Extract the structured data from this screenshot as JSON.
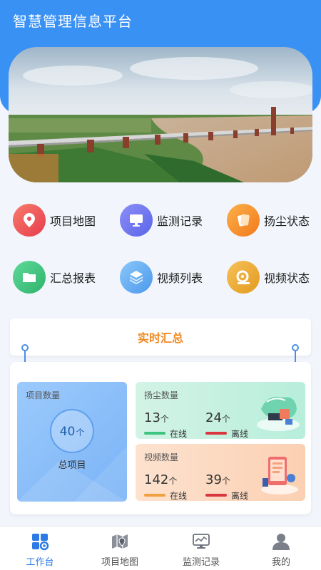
{
  "app": {
    "title": "智慧管理信息平台"
  },
  "menu": [
    {
      "label": "项目地图",
      "icon": "map-pin-icon",
      "color": "#f0565c"
    },
    {
      "label": "监测记录",
      "icon": "monitor-icon",
      "color": "#6b7cf3"
    },
    {
      "label": "扬尘状态",
      "icon": "dust-status-icon",
      "color": "#f7932c"
    },
    {
      "label": "汇总报表",
      "icon": "folder-icon",
      "color": "#3ec47e"
    },
    {
      "label": "视频列表",
      "icon": "video-list-icon",
      "color": "#5aa8f2"
    },
    {
      "label": "视频状态",
      "icon": "video-status-icon",
      "color": "#e6a42a"
    }
  ],
  "summary": {
    "title": "实时汇总",
    "project": {
      "title": "项目数量",
      "count": "40",
      "unit": "个",
      "caption": "总项目"
    },
    "dust": {
      "title": "扬尘数量",
      "online": "13",
      "offline": "24",
      "unit": "个",
      "online_label": "在线",
      "offline_label": "离线"
    },
    "video": {
      "title": "视频数量",
      "online": "142",
      "offline": "39",
      "unit": "个",
      "online_label": "在线",
      "offline_label": "离线"
    }
  },
  "colors": {
    "primary": "#3a91f4",
    "accent_orange": "#f08a24",
    "online_green": "#3ec47e",
    "offline_red": "#d9363e",
    "online_orange": "#f0a040"
  },
  "tabs": [
    {
      "label": "工作台",
      "icon": "workbench-icon",
      "active": true
    },
    {
      "label": "项目地图",
      "icon": "map-icon",
      "active": false
    },
    {
      "label": "监测记录",
      "icon": "monitor-icon",
      "active": false
    },
    {
      "label": "我的",
      "icon": "user-icon",
      "active": false
    }
  ]
}
